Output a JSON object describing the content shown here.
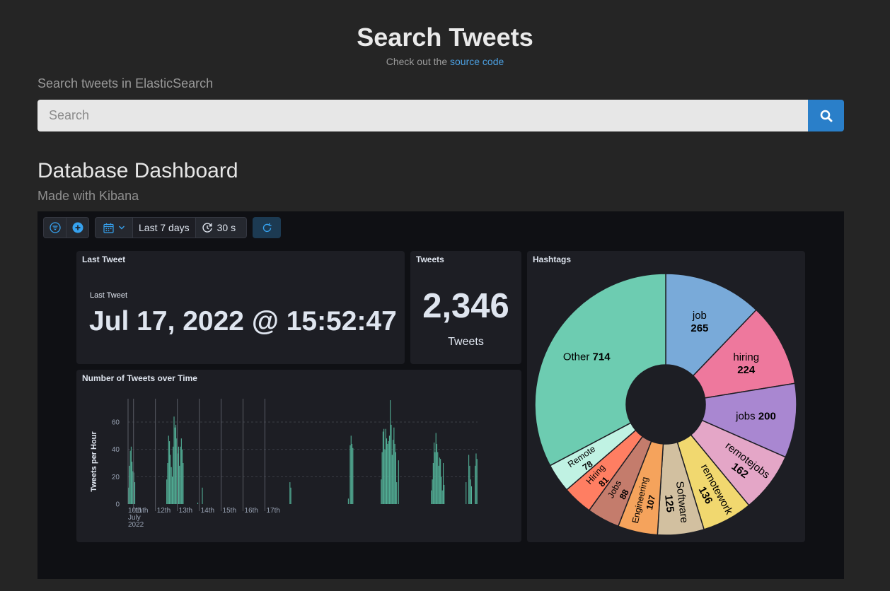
{
  "header": {
    "title": "Search Tweets",
    "subtitle_prefix": "Check out the",
    "subtitle_link": "source code"
  },
  "search": {
    "label": "Search tweets in ElasticSearch",
    "placeholder": "Search",
    "button_icon": "search-icon"
  },
  "dashboard": {
    "title": "Database Dashboard",
    "subtitle": "Made with Kibana"
  },
  "toolbar": {
    "filter_icon": "filter-icon",
    "add_icon": "plus-circle-icon",
    "calendar_icon": "calendar-icon",
    "time_range": "Last 7 days",
    "refresh_icon": "refresh-interval-icon",
    "refresh_interval": "30 s",
    "update_icon": "refresh-icon"
  },
  "panels": {
    "last_tweet": {
      "title": "Last Tweet",
      "label": "Last Tweet",
      "value": "Jul 17, 2022 @ 15:52:47"
    },
    "tweets": {
      "title": "Tweets",
      "value": "2,346",
      "label": "Tweets"
    },
    "histogram_title": "Number of Tweets over Time",
    "hashtags_title": "Hashtags"
  },
  "colors": {
    "bars": "#54b399",
    "accent": "#2a7fc9"
  },
  "chart_data": [
    {
      "type": "bar",
      "title": "Number of Tweets over Time",
      "ylabel": "Tweets per Hour",
      "xlabel": "",
      "ylim": [
        0,
        75
      ],
      "y_ticks": [
        0,
        20,
        40,
        60
      ],
      "x_ticks": [
        "10th July 2022",
        "11th",
        "12th",
        "13th",
        "14th",
        "15th",
        "16th",
        "17th"
      ],
      "grid": true,
      "series": [
        {
          "values": [
            12,
            28,
            39,
            42,
            31,
            24,
            23,
            16,
            0,
            0,
            0,
            0,
            0,
            0,
            0,
            0,
            0,
            0,
            0,
            0,
            0,
            0,
            0,
            0,
            0,
            0,
            0,
            0,
            0,
            0,
            0,
            0,
            0,
            0,
            0,
            0,
            0,
            0,
            0,
            0,
            0,
            0,
            18,
            30,
            50,
            46,
            36,
            27,
            20,
            42,
            64,
            56,
            58,
            48,
            37,
            42,
            28,
            42,
            48,
            40,
            30,
            0,
            0,
            0,
            0,
            0,
            0,
            0,
            0,
            0,
            0,
            0,
            0,
            0,
            0,
            0,
            1,
            0,
            0,
            0,
            0,
            12,
            0,
            0,
            0,
            0,
            0,
            0,
            0,
            0,
            0,
            0,
            0,
            0,
            0,
            0,
            0,
            0,
            0,
            0,
            0,
            0,
            0,
            0,
            0,
            0,
            0,
            0,
            0,
            0,
            0,
            0,
            0,
            0,
            0,
            0,
            0,
            0,
            0,
            0,
            0,
            0,
            0,
            0,
            0,
            0,
            0,
            0,
            0,
            0,
            0,
            0,
            0,
            0,
            0,
            0,
            0,
            0,
            0,
            0,
            0,
            0,
            0,
            0,
            0,
            0,
            0,
            0,
            0,
            0,
            0,
            0,
            0,
            0,
            0,
            0,
            0,
            0,
            0,
            0,
            0,
            0,
            0,
            0,
            0,
            0,
            0,
            0,
            0,
            0,
            0,
            0,
            0,
            0,
            0,
            0,
            0,
            16,
            12,
            0,
            0,
            0,
            0,
            0,
            0,
            0,
            0,
            0,
            0,
            0,
            0,
            0,
            0,
            0,
            0,
            0,
            0,
            0,
            0,
            0,
            0,
            0,
            0,
            0,
            0,
            0,
            0,
            0,
            0,
            0,
            0,
            0,
            0,
            0,
            0,
            0,
            0,
            0,
            0,
            0,
            0,
            0,
            0,
            0,
            0,
            0,
            0,
            0,
            0,
            0,
            0,
            0,
            0,
            0,
            0,
            0,
            0,
            0,
            0,
            0,
            0,
            4,
            0,
            43,
            50,
            44,
            41,
            0,
            0,
            0,
            0,
            0,
            0,
            0,
            0,
            0,
            0,
            0,
            0,
            0,
            0,
            0,
            0,
            0,
            0,
            0,
            0,
            0,
            0,
            0,
            0,
            0,
            0,
            0,
            0,
            0,
            0,
            18,
            38,
            53,
            55,
            40,
            55,
            48,
            44,
            46,
            50,
            76,
            58,
            36,
            47,
            56,
            44,
            38,
            16,
            0,
            32,
            0,
            0,
            0,
            0,
            0,
            0,
            0,
            0,
            0,
            0,
            0,
            0,
            0,
            0,
            0,
            0,
            0,
            0,
            0,
            0,
            0,
            0,
            0,
            0,
            0,
            0,
            0,
            0,
            0,
            0,
            0,
            0,
            0,
            0,
            0,
            10,
            18,
            30,
            45,
            38,
            52,
            44,
            38,
            28,
            34,
            33,
            20,
            10,
            30,
            14,
            0,
            0,
            0,
            0,
            0,
            0,
            0,
            0,
            0,
            0,
            0,
            0,
            0,
            0,
            0,
            0,
            0,
            0,
            0,
            0,
            0,
            0,
            0,
            16,
            0,
            0,
            36,
            28,
            18,
            13,
            0,
            0,
            0,
            28,
            37,
            33
          ]
        }
      ]
    },
    {
      "type": "pie",
      "title": "Hashtags",
      "slices": [
        {
          "label": "job",
          "value": 265,
          "color": "#79aad9"
        },
        {
          "label": "hiring",
          "value": 224,
          "color": "#ee789d"
        },
        {
          "label": "jobs",
          "value": 200,
          "color": "#a987d1"
        },
        {
          "label": "remotejobs",
          "value": 162,
          "color": "#e4a6c7"
        },
        {
          "label": "remotework",
          "value": 136,
          "color": "#f1d86f"
        },
        {
          "label": "Software",
          "value": 125,
          "color": "#d2c0a0"
        },
        {
          "label": "Engineering",
          "value": 107,
          "color": "#f5a35c"
        },
        {
          "label": "Jobs",
          "value": 88,
          "color": "#c47c6c"
        },
        {
          "label": "Hiring",
          "value": 81,
          "color": "#ff7e62"
        },
        {
          "label": "Remote",
          "value": 78,
          "color": "#c0f2e3"
        },
        {
          "label": "Other",
          "value": 714,
          "color": "#6dccb1"
        }
      ]
    }
  ]
}
